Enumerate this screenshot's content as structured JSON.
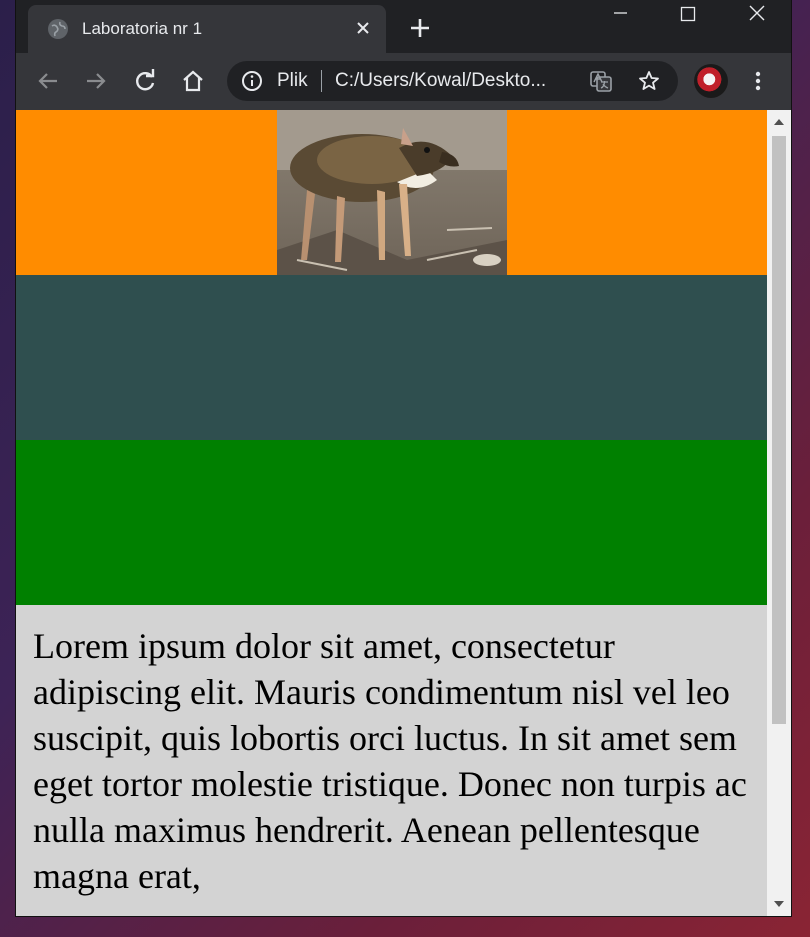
{
  "browser": {
    "tab": {
      "title": "Laboratoria nr 1",
      "close_glyph": "✕",
      "favicon": "globe-icon"
    },
    "new_tab_glyph": "+",
    "window_controls": [
      "minimize-icon",
      "maximize-icon",
      "close-icon"
    ],
    "toolbar": {
      "back": "arrow-left-icon",
      "forward": "arrow-right-icon",
      "reload": "reload-icon",
      "home": "home-icon"
    },
    "omnibox": {
      "scheme_label": "Plik",
      "url": "C:/Users/Kowal/Deskto..."
    },
    "colors": {
      "frame": "#202124",
      "toolbar": "#35363a",
      "text": "#e8eaed"
    }
  },
  "page": {
    "bands": [
      {
        "name": "orange",
        "color": "#ff8c00"
      },
      {
        "name": "slate",
        "color": "#2f4f4f"
      },
      {
        "name": "green",
        "color": "#008000"
      }
    ],
    "image_subject": "mouse-deer-photo",
    "text_background": "#d3d3d3",
    "paragraph": "Lorem ipsum dolor sit amet, consectetur adipiscing elit. Mauris condimentum nisl vel leo suscipit, quis lobortis orci luctus. In sit amet sem eget tortor molestie tristique. Donec non turpis ac nulla maximus hendrerit. Aenean pellentesque magna erat, "
  }
}
